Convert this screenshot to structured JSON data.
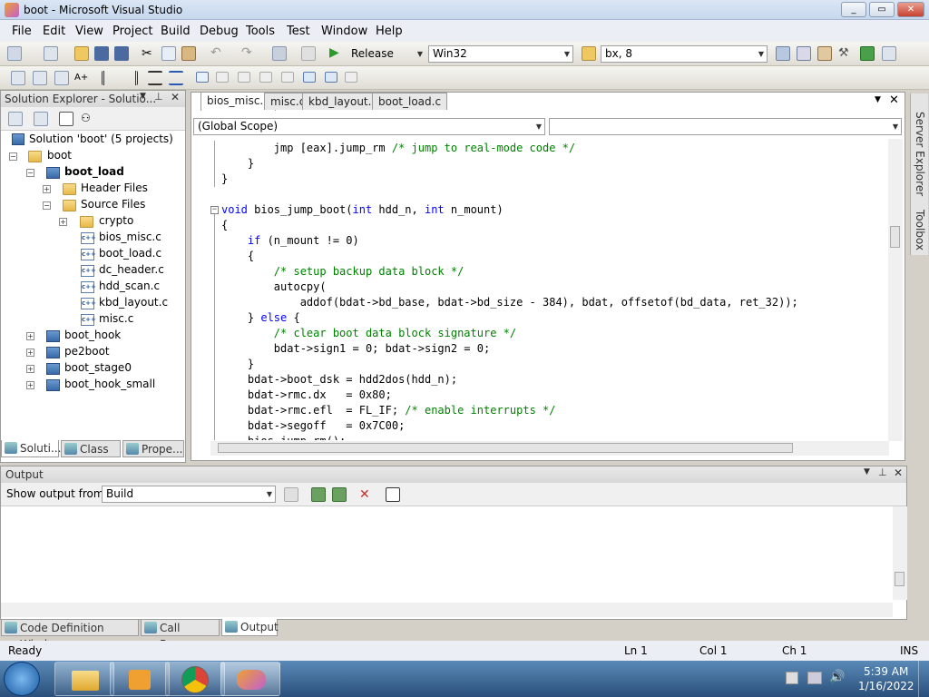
{
  "window": {
    "title": "boot - Microsoft Visual Studio",
    "min": "0",
    "max": "1",
    "close": "r"
  },
  "menu": [
    "File",
    "Edit",
    "View",
    "Project",
    "Build",
    "Debug",
    "Tools",
    "Test",
    "Window",
    "Help"
  ],
  "toolbar": {
    "configuration": "Release",
    "platform": "Win32",
    "find_text": "bx, 8"
  },
  "solution_explorer": {
    "title": "Solution Explorer - Solutio...",
    "solution_label": "Solution 'boot' (5 projects)",
    "items": [
      {
        "label": "boot",
        "kind": "folder"
      },
      {
        "label": "boot_load",
        "kind": "project"
      },
      {
        "label": "Header Files",
        "kind": "folder"
      },
      {
        "label": "Source Files",
        "kind": "folder"
      },
      {
        "label": "crypto",
        "kind": "folder"
      },
      {
        "label": "bios_misc.c",
        "kind": "cfile"
      },
      {
        "label": "boot_load.c",
        "kind": "cfile"
      },
      {
        "label": "dc_header.c",
        "kind": "cfile"
      },
      {
        "label": "hdd_scan.c",
        "kind": "cfile"
      },
      {
        "label": "kbd_layout.c",
        "kind": "cfile"
      },
      {
        "label": "misc.c",
        "kind": "cfile"
      },
      {
        "label": "boot_hook",
        "kind": "project"
      },
      {
        "label": "pe2boot",
        "kind": "project"
      },
      {
        "label": "boot_stage0",
        "kind": "project"
      },
      {
        "label": "boot_hook_small",
        "kind": "project"
      }
    ],
    "bottom_tabs": [
      "Soluti...",
      "Class ...",
      "Prope..."
    ]
  },
  "editor": {
    "tabs": [
      "bios_misc.c",
      "misc.c",
      "kbd_layout.c",
      "boot_load.c"
    ],
    "scope": "(Global Scope)",
    "side_tabs": [
      "Server Explorer",
      "Toolbox"
    ],
    "lines": [
      [
        [
          "        jmp [eax].jump_rm ",
          ""
        ],
        [
          "/* jump to real-mode code */",
          "cm"
        ]
      ],
      [
        [
          "    }",
          ""
        ]
      ],
      [
        [
          "}",
          ""
        ]
      ],
      [
        [
          "",
          ""
        ]
      ],
      [
        [
          "void",
          "kw"
        ],
        [
          " bios_jump_boot(",
          ""
        ],
        [
          "int",
          "kw"
        ],
        [
          " hdd_n, ",
          ""
        ],
        [
          "int",
          "kw"
        ],
        [
          " n_mount)",
          ""
        ]
      ],
      [
        [
          "{",
          ""
        ]
      ],
      [
        [
          "    ",
          ""
        ],
        [
          "if",
          "kw"
        ],
        [
          " (n_mount != 0)",
          ""
        ]
      ],
      [
        [
          "    {",
          ""
        ]
      ],
      [
        [
          "        ",
          ""
        ],
        [
          "/* setup backup data block */",
          "cm"
        ]
      ],
      [
        [
          "        autocpy(",
          ""
        ]
      ],
      [
        [
          "            addof(bdat->bd_base, bdat->bd_size - 384), bdat, offsetof(bd_data, ret_32));",
          ""
        ]
      ],
      [
        [
          "    } ",
          ""
        ],
        [
          "else",
          "kw"
        ],
        [
          " {",
          ""
        ]
      ],
      [
        [
          "        ",
          ""
        ],
        [
          "/* clear boot data block signature */",
          "cm"
        ]
      ],
      [
        [
          "        bdat->sign1 = 0; bdat->sign2 = 0;",
          ""
        ]
      ],
      [
        [
          "    }",
          ""
        ]
      ],
      [
        [
          "    bdat->boot_dsk = hdd2dos(hdd_n);",
          ""
        ]
      ],
      [
        [
          "    bdat->rmc.dx   = 0x80;",
          ""
        ]
      ],
      [
        [
          "    bdat->rmc.efl  = FL_IF; ",
          ""
        ],
        [
          "/* enable interrupts */",
          "cm"
        ]
      ],
      [
        [
          "    bdat->segoff   = 0x7C00;",
          ""
        ]
      ],
      [
        [
          "    bios_jump_rm();",
          ""
        ]
      ]
    ]
  },
  "output": {
    "title": "Output",
    "show_from_label": "Show output from:",
    "show_from_value": "Build",
    "bottom_tabs": [
      "Code Definition Window",
      "Call Browser",
      "Output"
    ]
  },
  "status": {
    "ready": "Ready",
    "ln": "Ln 1",
    "col": "Col 1",
    "ch": "Ch 1",
    "mode": "INS"
  },
  "taskbar": {
    "time": "5:39 AM",
    "date": "1/16/2022"
  },
  "colors": {
    "keyword": "#0000ff",
    "comment": "#008000",
    "titlebar": "#c6d7ee"
  }
}
